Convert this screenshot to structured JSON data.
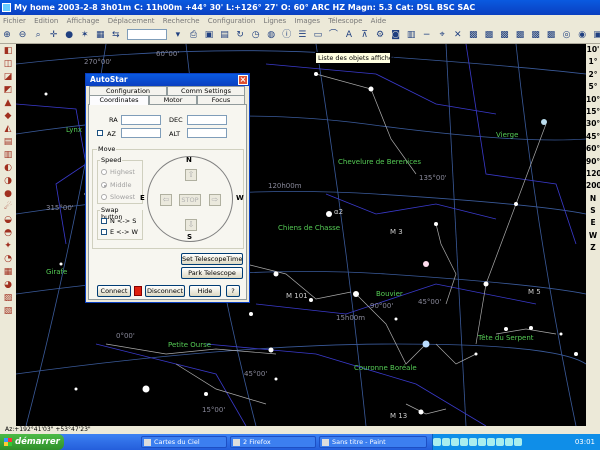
{
  "window": {
    "title": "My home 2003-2-8   3h01m C: 11h00m +44° 30' L:+126° 27' O: 60° ARC HZ  Magn: 5.3 Cat: DSL BSC SAC"
  },
  "menu": [
    "Fichier",
    "Edition",
    "Affichage",
    "Déplacement",
    "Recherche",
    "Configuration",
    "Lignes",
    "Images",
    "Télescope",
    "Aide"
  ],
  "tooltip": "Liste des objets affichés",
  "right_toolbar": [
    "10'",
    "1°",
    "2°",
    "5°",
    "10°",
    "15°",
    "30°",
    "45°",
    "60°",
    "90°",
    "120°",
    "200°",
    "N",
    "S",
    "E",
    "W",
    "Z"
  ],
  "autostar": {
    "title": "AutoStar",
    "tabs": [
      "Configuration",
      "Comm Settings",
      "Coordinates",
      "Motor",
      "Focus"
    ],
    "active_tab": "Coordinates",
    "ra_label": "RA",
    "dec_label": "DEC",
    "az_label": "AZ",
    "alt_label": "ALT",
    "move_label": "Move",
    "speed_label": "Speed",
    "speeds": [
      "Highest",
      "Middle",
      "Slowest"
    ],
    "swap_label": "Swap button",
    "swap_ns": "N <-> S",
    "swap_ew": "E <-> W",
    "dirs": {
      "n": "N",
      "s": "S",
      "e": "E",
      "w": "W"
    },
    "stop": "STOP",
    "set_time": "Set TelescopeTime",
    "park": "Park Telescope",
    "connect": "Connect",
    "disconnect": "Disconnect",
    "hide": "Hide",
    "help": "?"
  },
  "sky_labels": {
    "lynx": "Lynx",
    "girafe": "Girafe",
    "vierge": "Vierge",
    "chevelure": "Chevelure de Berenices",
    "chiens": "Chiens de Chasse",
    "bouvier": "Bouvier",
    "couronne": "Couronne Boréale",
    "serpent": "Tête du Serpent",
    "dragon": "Petite Ourse",
    "m3": "M 3",
    "m101": "M 101",
    "m5": "M 5",
    "m13": "M 13",
    "alpha2": "α2",
    "ra270": "270°00'",
    "ra315": "315°00'",
    "ra120": "120h00m",
    "ra135": "135°00'",
    "ra150": "15h00m",
    "ra90": "90°00'",
    "ra45": "45°00'",
    "ra45b": "45°00'",
    "ra0": "0°00'",
    "ra15": "15°00'",
    "ra60": "60°00'"
  },
  "status": "Az:+192°41'03\" +53°47'23\"",
  "taskbar": {
    "start": "démarrer",
    "tasks": [
      "Cartes du Ciel",
      "2 Firefox",
      "Sans titre - Paint"
    ],
    "clock": "03:01"
  }
}
